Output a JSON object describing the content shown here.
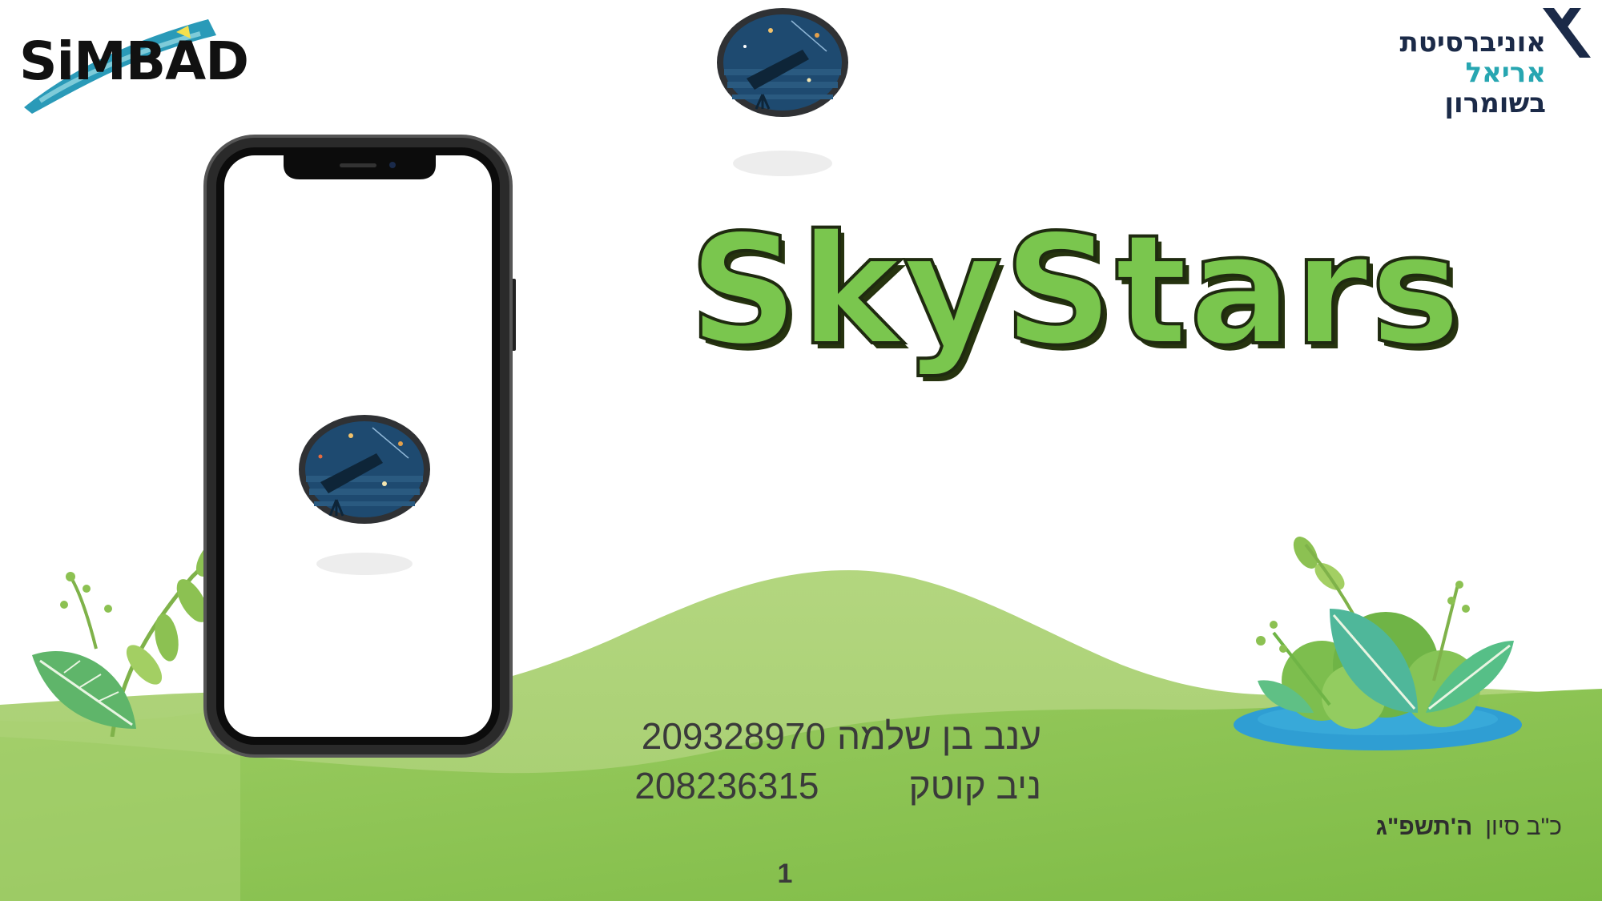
{
  "title": "SkyStars",
  "authors": [
    {
      "name": "ענב בן שלמה",
      "id": "209328970"
    },
    {
      "name": "ניב קוטק",
      "id": "208236315"
    }
  ],
  "date": {
    "day": "כ\"ב סיון",
    "year": "ה'תשפ\"ג"
  },
  "page_number": "1",
  "university": {
    "line1": "אוניברסיטת",
    "line2": "אריאל",
    "line3": "בשומרון"
  },
  "simbad_logo_text": "SiMBAD",
  "icons": [
    "telescope-app-icon",
    "smartphone-mockup",
    "leaf-plant-left",
    "leaf-plant-right",
    "pond",
    "university-mark-icon"
  ],
  "colors": {
    "title_green": "#7ac64e",
    "hill_light": "#b6d88a",
    "hill_dark": "#8cc152",
    "teal": "#27a6b1",
    "navy": "#1b2a48"
  }
}
